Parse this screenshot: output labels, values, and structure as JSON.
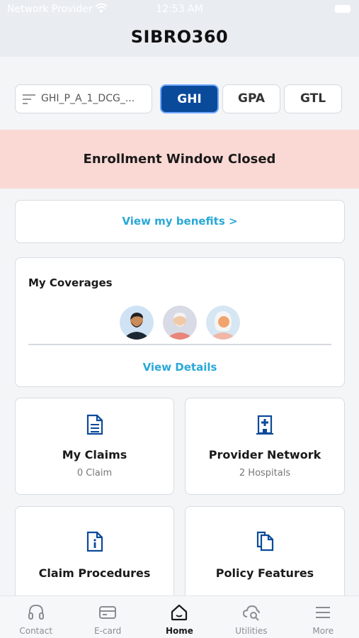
{
  "status_bar": {
    "carrier": "Network Provider",
    "time": "12:53 AM"
  },
  "app_title": "SIBRO360",
  "policy_select": {
    "value": "GHI_P_A_1_DCG_..."
  },
  "chips": [
    {
      "label": "GHI",
      "active": true
    },
    {
      "label": "GPA",
      "active": false
    },
    {
      "label": "GTL",
      "active": false
    }
  ],
  "banner": {
    "text": "Enrollment Window Closed"
  },
  "benefits_link": "View my benefits >",
  "coverages": {
    "title": "My Coverages",
    "view_details": "View Details"
  },
  "tiles": [
    {
      "title": "My Claims",
      "sub": "0 Claim",
      "icon": "document-icon"
    },
    {
      "title": "Provider Network",
      "sub": "2 Hospitals",
      "icon": "hospital-icon"
    },
    {
      "title": "Claim Procedures",
      "icon": "info-document-icon"
    },
    {
      "title": "Policy Features",
      "icon": "documents-icon"
    }
  ],
  "tabs": [
    {
      "label": "Contact",
      "icon": "headset-icon"
    },
    {
      "label": "E-card",
      "icon": "card-icon"
    },
    {
      "label": "Home",
      "icon": "home-icon",
      "active": true
    },
    {
      "label": "Utilities",
      "icon": "cloud-search-icon"
    },
    {
      "label": "More",
      "icon": "menu-icon"
    }
  ],
  "colors": {
    "primary": "#0a4a9a",
    "link": "#2aa8d6",
    "banner_bg": "#fad9d5",
    "icon": "#0a4a9a"
  }
}
